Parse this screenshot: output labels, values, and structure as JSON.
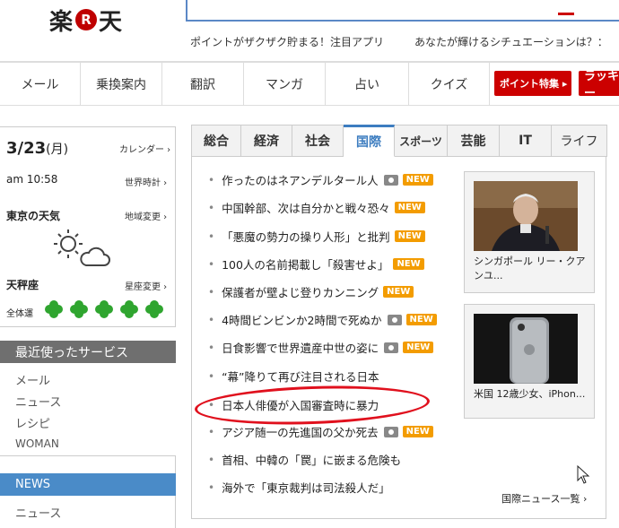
{
  "header": {
    "logo_left": "楽",
    "logo_mark": "R",
    "logo_right": "天",
    "promo_1": "ポイントがザクザク貯まる！注目アプリ",
    "promo_2": "あなたが輝けるシチュエーションは？："
  },
  "nav": {
    "items": [
      "メール",
      "乗換案内",
      "翻訳",
      "マンガ",
      "占い",
      "クイズ"
    ],
    "promo_button": "ポイント特集 ▸",
    "promo_button_2": "ラッキー"
  },
  "left": {
    "date": "3/23",
    "weekday": "(月)",
    "calendar_link": "カレンダー ›",
    "time": "am 10:58",
    "worldclock_link": "世界時計 ›",
    "weather_title": "東京の天気",
    "region_link": "地域変更 ›",
    "fortune_title": "天秤座",
    "sign_link": "星座変更 ›",
    "fortune_label": "全体運",
    "recent_title": "最近使ったサービス",
    "recent_items": [
      "メール",
      "ニュース",
      "レシピ",
      "WOMAN"
    ],
    "news_title": "NEWS",
    "news_items": [
      "ニュース"
    ]
  },
  "tabs": [
    "総合",
    "経済",
    "社会",
    "国際",
    "スポーツ",
    "芸能",
    "IT",
    "ライフ"
  ],
  "active_tab": "国際",
  "headlines": [
    {
      "text": "作ったのはネアンデルタール人",
      "camera": true,
      "new": "NEW"
    },
    {
      "text": "中国幹部、次は自分かと戦々恐々",
      "camera": false,
      "new": "NEW"
    },
    {
      "text": "「悪魔の勢力の操り人形」と批判",
      "camera": false,
      "new": "NEW"
    },
    {
      "text": "100人の名前掲載し「殺害せよ」",
      "camera": false,
      "new": "NEW"
    },
    {
      "text": "保護者が壁よじ登りカンニング",
      "camera": false,
      "new": "NEW"
    },
    {
      "text": "4時間ビンビンか2時間で死ぬか",
      "camera": true,
      "new": "NEW"
    },
    {
      "text": "日食影響で世界遺産中世の姿に",
      "camera": true,
      "new": "NEW"
    },
    {
      "text": "“幕”降りて再び注目される日本",
      "camera": false,
      "new": ""
    },
    {
      "text": "日本人俳優が入国審査時に暴力",
      "camera": false,
      "new": ""
    },
    {
      "text": "アジア随一の先進国の父か死去",
      "camera": true,
      "new": "NEW"
    },
    {
      "text": "首相、中韓の「罠」に嵌まる危険も",
      "camera": false,
      "new": ""
    },
    {
      "text": "海外で「東京裁判は司法殺人だ」",
      "camera": false,
      "new": ""
    }
  ],
  "side_cards": [
    {
      "caption": "シンガポール リー・クアンユ..."
    },
    {
      "caption": "米国 12歳少女、iPhon..."
    }
  ],
  "more_link": "国際ニュース一覧 ›",
  "colors": {
    "brand_red": "#bf0000",
    "tab_active": "#3d7dc0",
    "new_badge": "#f39c00",
    "highlight_oval": "#e0101d",
    "news_header": "#4a8bc8",
    "clover_green": "#2fa52f"
  }
}
